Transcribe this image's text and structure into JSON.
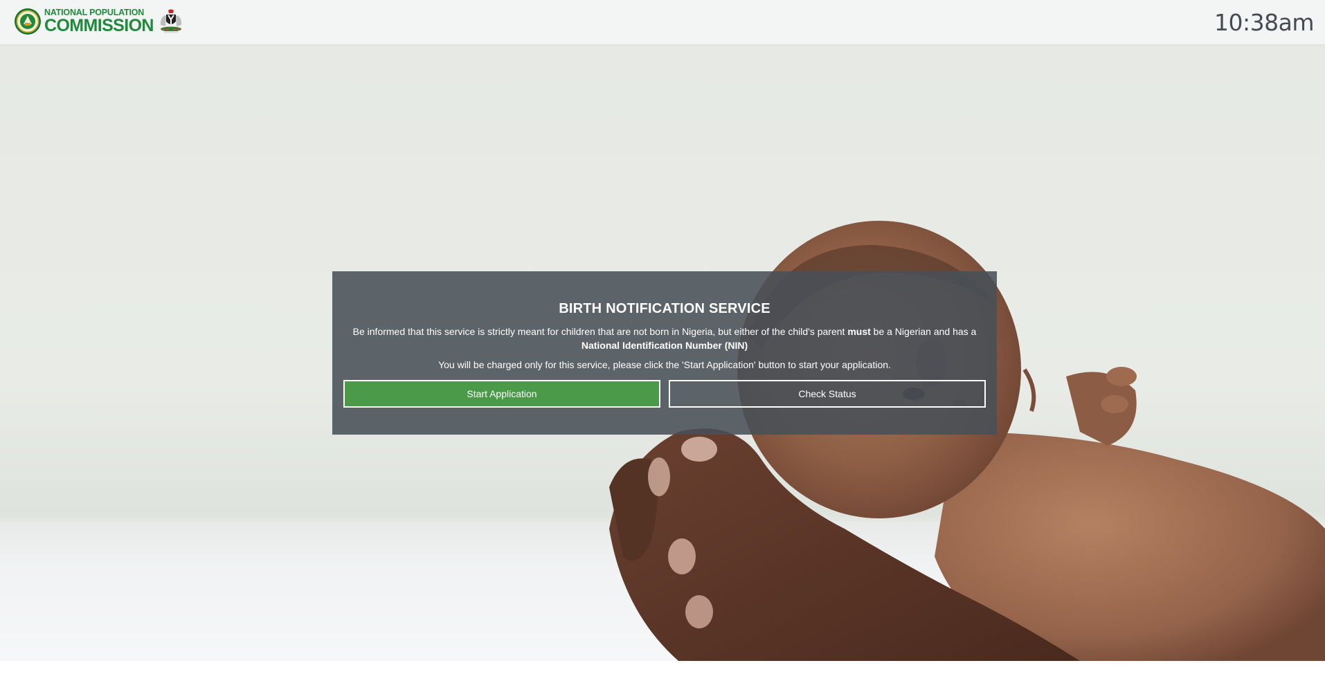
{
  "header": {
    "logo": {
      "line1": "NATIONAL POPULATION",
      "line2": "COMMISSION"
    },
    "clock": "10:38am"
  },
  "notice": {
    "title": "BIRTH NOTIFICATION SERVICE",
    "text_part1": "Be informed that this service is strictly meant for children that are not born in Nigeria, but either of the child's parent",
    "text_bold1": "must",
    "text_part2": "be a Nigerian and has a",
    "text_bold2": "National Identification Number (NIN)",
    "charge_text": "You will be charged only for this service, please click the 'Start Application' button to start your application."
  },
  "buttons": {
    "start_label": "Start Application",
    "status_label": "Check Status"
  },
  "colors": {
    "brand_green": "#1f8a3b",
    "start_button": "#4a9a4a",
    "panel_overlay": "#485058"
  },
  "icons": {
    "logo_badge": "npc-seal-icon",
    "coat_of_arms": "nigeria-coat-of-arms-icon"
  }
}
